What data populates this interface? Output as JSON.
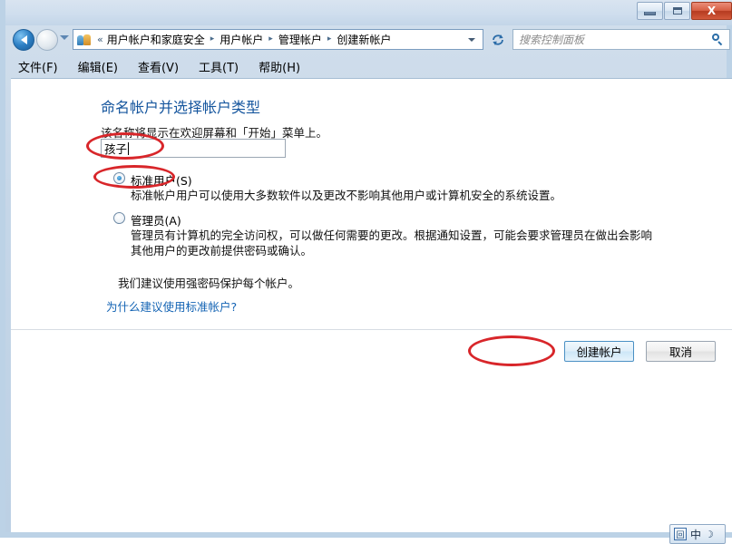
{
  "window": {
    "controls": {
      "minimize_label": "最小化",
      "maximize_label": "最大化",
      "close_label": "X"
    }
  },
  "navigation": {
    "back_label": "后退",
    "forward_label": "前进",
    "history_label": "最近访问的位置",
    "refresh_label": "刷新",
    "chevrons": "«",
    "separator": "▸"
  },
  "breadcrumb": {
    "items": [
      {
        "label": "用户帐户和家庭安全"
      },
      {
        "label": "用户帐户"
      },
      {
        "label": "管理帐户"
      },
      {
        "label": "创建新帐户"
      }
    ]
  },
  "search": {
    "placeholder": "搜索控制面板",
    "value": ""
  },
  "menubar": {
    "items": [
      {
        "label": "文件(F)"
      },
      {
        "label": "编辑(E)"
      },
      {
        "label": "查看(V)"
      },
      {
        "label": "工具(T)"
      },
      {
        "label": "帮助(H)"
      }
    ]
  },
  "main": {
    "heading": "命名帐户并选择帐户类型",
    "subtext": "该名称将显示在欢迎屏幕和「开始」菜单上。",
    "account_name": {
      "value": "孩子",
      "placeholder": ""
    },
    "account_types": [
      {
        "id": "standard",
        "label": "标准用户(S)",
        "selected": true,
        "description": "标准帐户用户可以使用大多数软件以及更改不影响其他用户或计算机安全的系统设置。"
      },
      {
        "id": "administrator",
        "label": "管理员(A)",
        "selected": false,
        "description": "管理员有计算机的完全访问权，可以做任何需要的更改。根据通知设置，可能会要求管理员在做出会影响其他用户的更改前提供密码或确认。"
      }
    ],
    "recommendation": "我们建议使用强密码保护每个帐户。",
    "help_link": "为什么建议使用标准帐户?"
  },
  "buttons": {
    "create": "创建帐户",
    "cancel": "取消"
  },
  "ime": {
    "logo": "回",
    "mode": "中",
    "moon": "☽"
  },
  "colors": {
    "heading": "#16569e",
    "link": "#1464b4",
    "annotation": "#d8262a",
    "titlebar_top": "#d9e4f0",
    "frame": "#bcd2e6",
    "close_button": "#b53b20"
  }
}
